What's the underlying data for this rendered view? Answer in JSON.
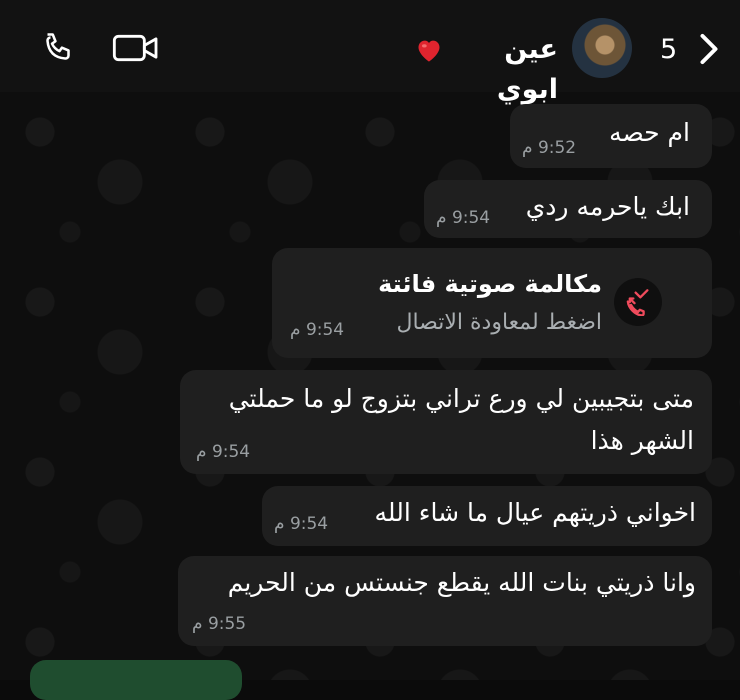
{
  "header": {
    "contact_name": "عين ابوي",
    "heart_emoji": "❤️",
    "unread_count": "5",
    "icons": [
      "phone-icon",
      "video-camera-icon",
      "chevron-right-icon"
    ]
  },
  "messages": [
    {
      "text": "ام حصه",
      "time": "9:52 م"
    },
    {
      "text": "ابك ياحرمه ردي",
      "time": "9:54 م"
    },
    {
      "title": "مكالمة صوتية فائتة",
      "subtitle": "اضغط لمعاودة الاتصال",
      "time": "9:54 م"
    },
    {
      "line1": "متى بتجيبين لي ورع تراني بتزوج لو ما حملتي",
      "line2": "الشهر هذا",
      "time": "9:54 م"
    },
    {
      "text": "اخواني ذريتهم عيال ما شاء الله",
      "time": "9:54 م"
    },
    {
      "text": "وانا ذريتي بنات الله يقطع جنستس من الحريم",
      "time": "9:55 م"
    }
  ],
  "colors": {
    "incoming_bubble": "#1f1f1f",
    "outgoing_bubble": "#1f4d2f",
    "missed_call_red": "#ef4b5c"
  }
}
